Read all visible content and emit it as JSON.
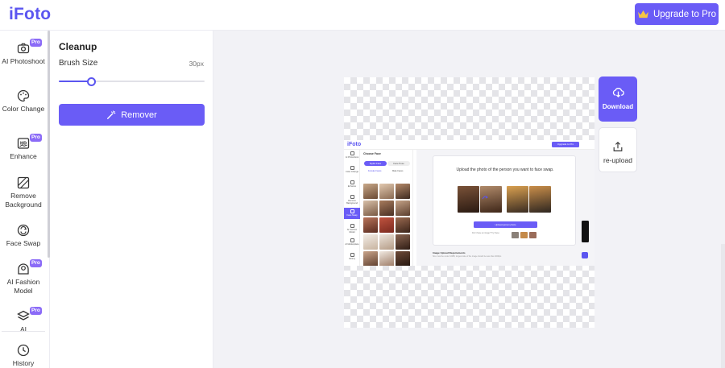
{
  "header": {
    "logo": "iFoto",
    "upgrade_label": "Upgrade to Pro",
    "brand_color": "#6a5cf6"
  },
  "sidebar": {
    "items": [
      {
        "label": "AI Photoshoot",
        "icon": "camera-icon",
        "pro": "Pro"
      },
      {
        "label": "Color Change",
        "icon": "palette-icon",
        "pro": ""
      },
      {
        "label": "Enhance",
        "icon": "hd-icon",
        "pro": "Pro"
      },
      {
        "label": "Remove Background",
        "icon": "eraser-icon",
        "pro": ""
      },
      {
        "label": "Face Swap",
        "icon": "face-swap-icon",
        "pro": ""
      },
      {
        "label": "AI Fashion Model",
        "icon": "model-icon",
        "pro": "Pro"
      },
      {
        "label": "AI",
        "icon": "layers-icon",
        "pro": "Pro"
      },
      {
        "label": "History",
        "icon": "clock-icon",
        "pro": ""
      }
    ]
  },
  "panel": {
    "title": "Cleanup",
    "brush_label": "Brush Size",
    "brush_value": "30px",
    "brush_fraction": 0.22,
    "remover_label": "Remover"
  },
  "actions": {
    "download_label": "Download",
    "reupload_label": "re-upload"
  },
  "embedded": {
    "logo": "iFoto",
    "upgrade_label": "Upgrade to Pro",
    "choose_face": "Choose Face",
    "tab_1": "Stylist Face",
    "tab_2": "Face Pose",
    "sub_1": "Female Faces",
    "sub_2": "Male Faces",
    "card_title": "Upload the photo of the person you want to face swap.",
    "upload_button": "Upload person photo",
    "hint": "Don't have an image? Try these:",
    "req_title": "Image Upload Requirements",
    "req_text": "Size must be under 10MB, longest side of the image should be less than 4000px.",
    "side_items": [
      "AI Photoshoot",
      "Color Change",
      "Enhance",
      "Remove Background",
      "Face Swap",
      "AI Fashion Model",
      "AI Marketplace",
      "History"
    ]
  }
}
